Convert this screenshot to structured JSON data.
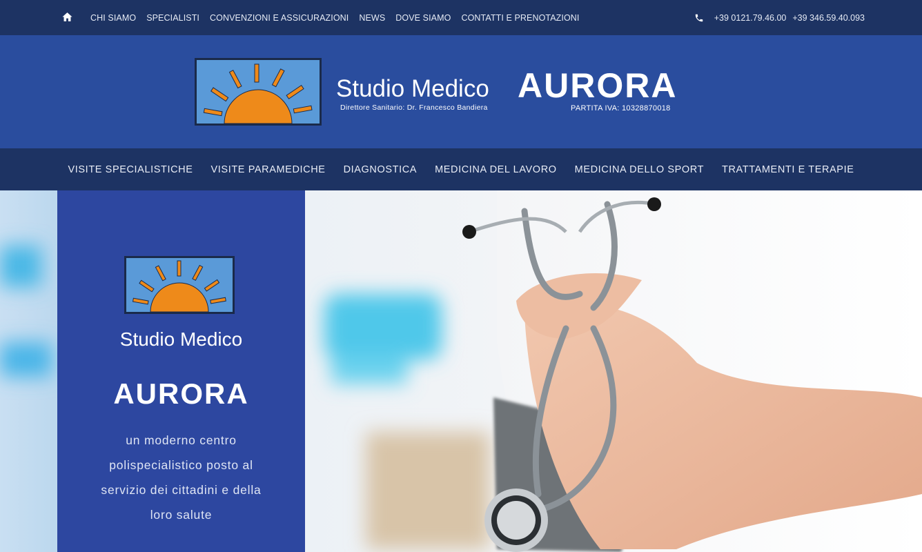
{
  "topbar": {
    "links": [
      "CHI SIAMO",
      "SPECIALISTI",
      "CONVENZIONI E ASSICURAZIONI",
      "NEWS",
      "DOVE SIAMO",
      "CONTATTI E PRENOTAZIONI"
    ],
    "phone_1": "+39 0121.79.46.00",
    "phone_2": "+39 346.59.40.093"
  },
  "brand": {
    "title": "Studio Medico",
    "subtitle": "Direttore Sanitario: Dr. Francesco Bandiera",
    "name": "AURORA",
    "vat": "PARTITA IVA: 10328870018"
  },
  "main_nav": {
    "items": [
      "VISITE SPECIALISTICHE",
      "VISITE PARAMEDICHE",
      "DIAGNOSTICA",
      "MEDICINA DEL LAVORO",
      "MEDICINA DELLO SPORT",
      "TRATTAMENTI E TERAPIE"
    ]
  },
  "hero": {
    "logo_title": "Studio Medico",
    "logo_name": "AURORA",
    "tagline": "un moderno centro polispecialistico posto al servizio dei cittadini e della loro salute"
  },
  "colors": {
    "topbar_bg": "#1d3363",
    "brand_bg": "#2a4d9e",
    "panel_bg": "#2d47a0",
    "logo_sky": "#5a9ad8",
    "sun_orange": "#ee8a1a"
  },
  "icons": {
    "home": "home-icon",
    "phone": "phone-icon",
    "logo": "sun-logo-icon"
  }
}
